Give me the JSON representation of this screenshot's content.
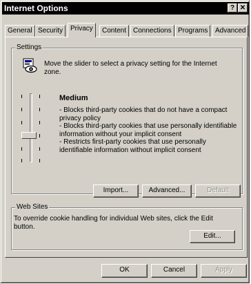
{
  "window": {
    "title": "Internet Options",
    "help_glyph": "?",
    "close_glyph": "✕"
  },
  "tabs": [
    {
      "label": "General"
    },
    {
      "label": "Security"
    },
    {
      "label": "Privacy",
      "active": true
    },
    {
      "label": "Content"
    },
    {
      "label": "Connections"
    },
    {
      "label": "Programs"
    },
    {
      "label": "Advanced"
    }
  ],
  "settings": {
    "group_title": "Settings",
    "intro": "Move the slider to select a privacy setting for the Internet zone.",
    "level_title": "Medium",
    "descriptions": [
      "- Blocks third-party cookies that do not have a compact privacy policy",
      "- Blocks third-party cookies that use personally identifiable information without your implicit consent",
      "- Restricts first-party cookies that use personally identifiable information without implicit consent"
    ],
    "slider": {
      "positions": 6,
      "selected_index": 3
    },
    "buttons": {
      "import": "Import...",
      "advanced": "Advanced...",
      "default": "Default"
    }
  },
  "web_sites": {
    "group_title": "Web Sites",
    "text": "To override cookie handling for individual Web sites, click the Edit button.",
    "edit_label": "Edit..."
  },
  "dialog_buttons": {
    "ok": "OK",
    "cancel": "Cancel",
    "apply": "Apply"
  }
}
